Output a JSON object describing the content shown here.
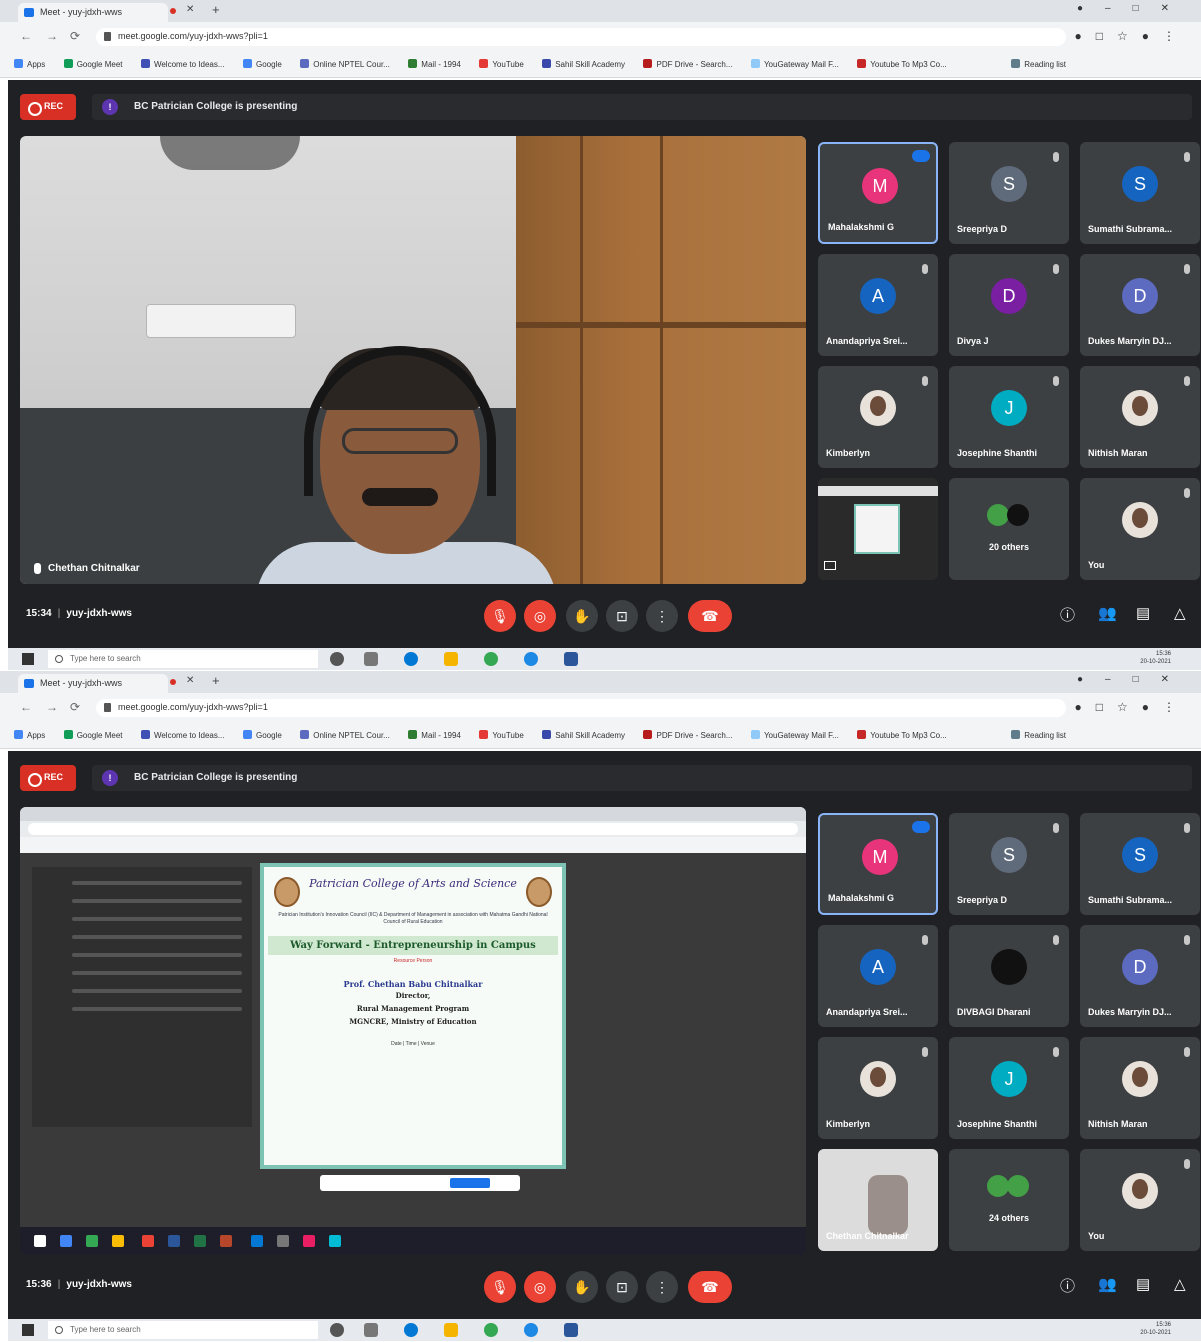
{
  "browser": {
    "tab_title": "Meet - yuy-jdxh-wws",
    "url": "meet.google.com/yuy-jdxh-wws?pli=1",
    "bookmarks": [
      "Apps",
      "Google Meet",
      "Welcome to Ideas...",
      "Google",
      "Online NPTEL Cour...",
      "Mail - 1994",
      "YouTube",
      "Sahil Skill Academy",
      "PDF Drive - Search...",
      "YouGateway Mail F...",
      "Youtube To Mp3 Co...",
      "Reading list"
    ]
  },
  "meet": {
    "rec_label": "REC",
    "presenting_label": "BC Patrician College is presenting",
    "meeting_code": "yuy-jdxh-wws",
    "main_speaker_label": "Chethan Chitnalkar"
  },
  "screens": [
    {
      "time": "15:34",
      "participants": [
        {
          "name": "Mahalakshmi G",
          "initial": "M",
          "color": "#e8347a",
          "active": true
        },
        {
          "name": "Sreepriya D",
          "initial": "S",
          "color": "#5f6b7a"
        },
        {
          "name": "Sumathi Subrama...",
          "initial": "S",
          "color": "#1565c0"
        },
        {
          "name": "Anandapriya Srei...",
          "initial": "A",
          "color": "#1565c0"
        },
        {
          "name": "Divya J",
          "initial": "D",
          "color": "#7b1fa2"
        },
        {
          "name": "Dukes Marryin DJ...",
          "initial": "D",
          "color": "#5c6bc0"
        },
        {
          "name": "Kimberlyn",
          "initial": "",
          "color": "photo"
        },
        {
          "name": "Josephine Shanthi",
          "initial": "J",
          "color": "#00acc1"
        },
        {
          "name": "Nithish Maran",
          "initial": "",
          "color": "photo"
        },
        {
          "name": "",
          "initial": "",
          "color": "presentation"
        },
        {
          "name": "20 others",
          "initial": "",
          "color": "others"
        },
        {
          "name": "You",
          "initial": "",
          "color": "photo"
        }
      ]
    },
    {
      "time": "15:36",
      "participants": [
        {
          "name": "Mahalakshmi G",
          "initial": "M",
          "color": "#e8347a",
          "active": true
        },
        {
          "name": "Sreepriya D",
          "initial": "S",
          "color": "#5f6b7a"
        },
        {
          "name": "Sumathi Subrama...",
          "initial": "S",
          "color": "#1565c0"
        },
        {
          "name": "Anandapriya Srei...",
          "initial": "A",
          "color": "#1565c0"
        },
        {
          "name": "DIVBAGI Dharani",
          "initial": "",
          "color": "photo"
        },
        {
          "name": "Dukes Marryin DJ...",
          "initial": "D",
          "color": "#5c6bc0"
        },
        {
          "name": "Kimberlyn",
          "initial": "",
          "color": "photo"
        },
        {
          "name": "Josephine Shanthi",
          "initial": "J",
          "color": "#00acc1"
        },
        {
          "name": "Nithish Maran",
          "initial": "",
          "color": "photo"
        },
        {
          "name": "Chethan Chitnalkar",
          "initial": "",
          "color": "speaker"
        },
        {
          "name": "24 others",
          "initial": "",
          "color": "others"
        },
        {
          "name": "You",
          "initial": "",
          "color": "photo"
        }
      ]
    }
  ],
  "flyer": {
    "college": "Patrician College of Arts and Science",
    "organizers": "Patrician Institution's Innovation Council (IIC) & Department of Management in association with Mahatma Gandhi National Council of Rural Education",
    "title": "Way Forward - Entrepreneurship in Campus",
    "resource_label": "Resource Person",
    "speaker": "Prof. Chethan Babu Chitnalkar",
    "role": "Director,",
    "program": "Rural Management Program",
    "org": "MGNCRE, Ministry of Education",
    "footer": "Date | Time | Venue"
  },
  "taskbar": {
    "search_placeholder": "Type here to search",
    "clock_time": "15:36",
    "clock_date": "20-10-2021"
  }
}
